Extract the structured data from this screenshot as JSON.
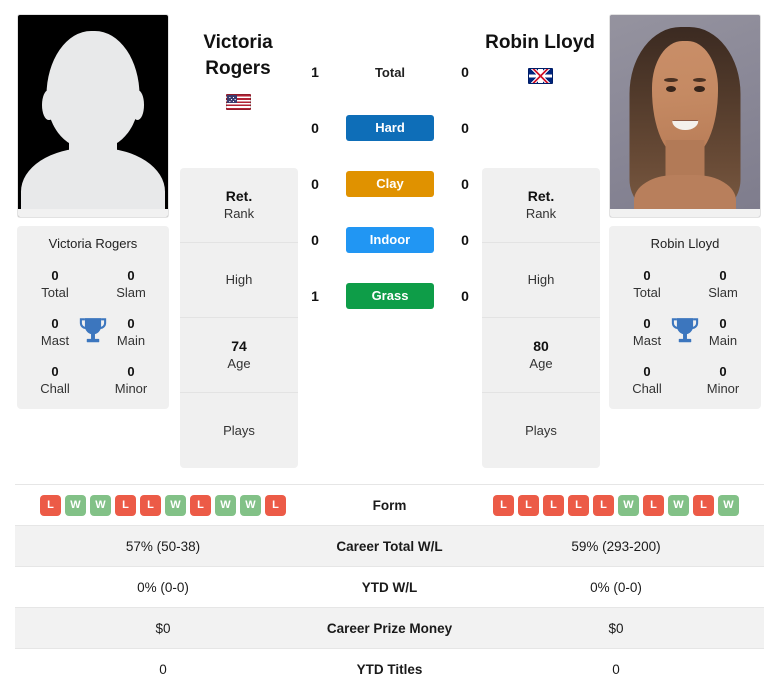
{
  "players": {
    "left": {
      "name": "Victoria Rogers",
      "name_line1": "Victoria",
      "name_line2": "Rogers",
      "flag_icon": "flag-us-icon",
      "photo_icon": "player-placeholder-avatar-icon",
      "rank_value": "Ret.",
      "rank_label": "Rank",
      "high_value": "",
      "high_label": "High",
      "age_value": "74",
      "age_label": "Age",
      "plays_value": "",
      "plays_label": "Plays",
      "titles": [
        {
          "value": "0",
          "label": "Total"
        },
        {
          "value": "0",
          "label": "Slam"
        },
        {
          "value": "0",
          "label": "Mast"
        },
        {
          "value": "0",
          "label": "Main"
        },
        {
          "value": "0",
          "label": "Chall"
        },
        {
          "value": "0",
          "label": "Minor"
        }
      ],
      "form": [
        "L",
        "W",
        "W",
        "L",
        "L",
        "W",
        "L",
        "W",
        "W",
        "L"
      ],
      "career_total_wl": "57% (50-38)",
      "ytd_wl": "0% (0-0)",
      "career_prize_money": "$0",
      "ytd_titles": "0"
    },
    "right": {
      "name": "Robin Lloyd",
      "name_line1": "Robin Lloyd",
      "name_line2": "",
      "flag_icon": "flag-gb-icon",
      "photo_icon": "player-portrait-photo",
      "rank_value": "Ret.",
      "rank_label": "Rank",
      "high_value": "",
      "high_label": "High",
      "age_value": "80",
      "age_label": "Age",
      "plays_value": "",
      "plays_label": "Plays",
      "titles": [
        {
          "value": "0",
          "label": "Total"
        },
        {
          "value": "0",
          "label": "Slam"
        },
        {
          "value": "0",
          "label": "Mast"
        },
        {
          "value": "0",
          "label": "Main"
        },
        {
          "value": "0",
          "label": "Chall"
        },
        {
          "value": "0",
          "label": "Minor"
        }
      ],
      "form": [
        "L",
        "L",
        "L",
        "L",
        "L",
        "W",
        "L",
        "W",
        "L",
        "W"
      ],
      "career_total_wl": "59% (293-200)",
      "ytd_wl": "0% (0-0)",
      "career_prize_money": "$0",
      "ytd_titles": "0"
    }
  },
  "head_to_head": {
    "total": {
      "label": "Total",
      "left": "1",
      "right": "0"
    },
    "surfaces": [
      {
        "label": "Hard",
        "color": "#0E6EB8",
        "left": "0",
        "right": "0"
      },
      {
        "label": "Clay",
        "color": "#E09200",
        "left": "0",
        "right": "0"
      },
      {
        "label": "Indoor",
        "color": "#2196F3",
        "left": "0",
        "right": "0"
      },
      {
        "label": "Grass",
        "color": "#0E9D48",
        "left": "1",
        "right": "0"
      }
    ]
  },
  "comparison_table": {
    "rows": [
      {
        "label": "Form",
        "left": "",
        "right": ""
      },
      {
        "label": "Career Total W/L",
        "left": "57% (50-38)",
        "right": "59% (293-200)"
      },
      {
        "label": "YTD W/L",
        "left": "0% (0-0)",
        "right": "0% (0-0)"
      },
      {
        "label": "Career Prize Money",
        "left": "$0",
        "right": "$0"
      },
      {
        "label": "YTD Titles",
        "left": "0",
        "right": "0"
      }
    ]
  },
  "colors": {
    "hard": "#0E6EB8",
    "clay": "#E09200",
    "indoor": "#2196F3",
    "grass": "#0E9D48",
    "win_chip": "#82C187",
    "loss_chip": "#EC5B47",
    "trophy": "#3C76BE",
    "card_bg": "#F0F0F0"
  }
}
